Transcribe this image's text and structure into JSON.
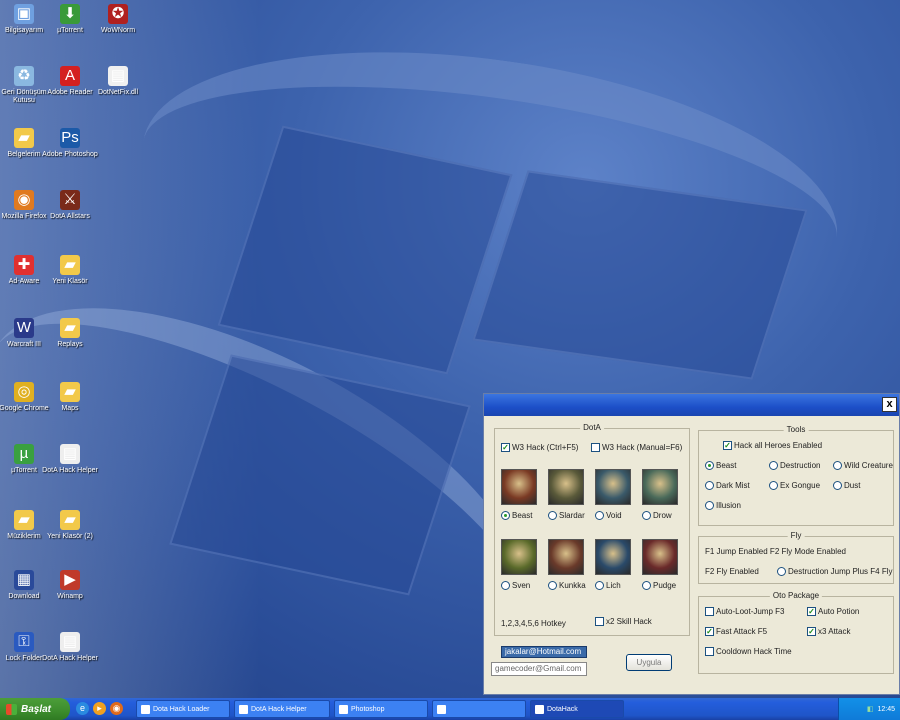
{
  "desktop": {
    "icons": [
      {
        "label": "Bilgisayarım",
        "icon": "computer-icon",
        "color": "#6fa0e0",
        "glyph": "▣"
      },
      {
        "label": "µTorrent",
        "icon": "download-icon",
        "color": "#3a9a3a",
        "glyph": "⬇"
      },
      {
        "label": "WoWNorm",
        "icon": "game-icon",
        "color": "#b02020",
        "glyph": "✪"
      },
      {
        "label": "Geri Dönüşüm Kutusu",
        "icon": "recycle-bin-icon",
        "color": "#8ab8e0",
        "glyph": "♻"
      },
      {
        "label": "Adobe Reader",
        "icon": "pdf-icon",
        "color": "#d42020",
        "glyph": "A"
      },
      {
        "label": "DotNetFix.dll",
        "icon": "file-icon",
        "color": "#f0f0f0",
        "glyph": "▤"
      },
      {
        "label": "Belgelerim",
        "icon": "folder-icon",
        "color": "#f2c94a",
        "glyph": "▰"
      },
      {
        "label": "Adobe Photoshop",
        "icon": "photoshop-icon",
        "color": "#1c5aa8",
        "glyph": "Ps"
      },
      {
        "label": "Mozilla Firefox",
        "icon": "firefox-icon",
        "color": "#e07a1f",
        "glyph": "◉"
      },
      {
        "label": "DotA Allstars",
        "icon": "warcraft-icon",
        "color": "#7a2a1a",
        "glyph": "⚔"
      },
      {
        "label": "Ad-Aware",
        "icon": "shield-icon",
        "color": "#e03030",
        "glyph": "✚"
      },
      {
        "label": "Yeni Klasör",
        "icon": "folder-icon",
        "color": "#f2c94a",
        "glyph": "▰"
      },
      {
        "label": "Warcraft III",
        "icon": "warcraft-icon",
        "color": "#2a3a8a",
        "glyph": "W"
      },
      {
        "label": "Replays",
        "icon": "folder-icon",
        "color": "#f2c94a",
        "glyph": "▰"
      },
      {
        "label": "Google Chrome",
        "icon": "chrome-icon",
        "color": "#e0b020",
        "glyph": "◎"
      },
      {
        "label": "Maps",
        "icon": "folder-icon",
        "color": "#f2c94a",
        "glyph": "▰"
      },
      {
        "label": "µTorrent",
        "icon": "utorrent-icon",
        "color": "#3aa040",
        "glyph": "µ"
      },
      {
        "label": "DotA Hack Helper",
        "icon": "file-icon",
        "color": "#eeeeee",
        "glyph": "▤"
      },
      {
        "label": "Müziklerim",
        "icon": "folder-icon",
        "color": "#f2c94a",
        "glyph": "▰"
      },
      {
        "label": "Yeni Klasör (2)",
        "icon": "folder-icon",
        "color": "#f2c94a",
        "glyph": "▰"
      },
      {
        "label": "Download",
        "icon": "app-icon",
        "color": "#2a4a9a",
        "glyph": "▦"
      },
      {
        "label": "Winamp",
        "icon": "winamp-icon",
        "color": "#c03a2a",
        "glyph": "▶"
      },
      {
        "label": "Lock Folder",
        "icon": "lock-icon",
        "color": "#2a5ac0",
        "glyph": "⚿"
      },
      {
        "label": "DotA Hack Helper",
        "icon": "file-icon",
        "color": "#eeeeee",
        "glyph": "▤"
      }
    ]
  },
  "window": {
    "close_label": "x",
    "dota_group": {
      "title": "DotA",
      "checkbox1": "W3 Hack (Ctrl+F5)",
      "checkbox2": "W3 Hack (Manual=F6)",
      "heroes": [
        {
          "name": "Beast",
          "color": "#7a3a24"
        },
        {
          "name": "Slardar",
          "color": "#5a5a3a"
        },
        {
          "name": "Void",
          "color": "#3a5a6a"
        },
        {
          "name": "Drow",
          "color": "#4a6a5a"
        },
        {
          "name": "Sven",
          "color": "#5a6a2a"
        },
        {
          "name": "Kunkka",
          "color": "#6a3a2a"
        },
        {
          "name": "Lich",
          "color": "#2a4a6a"
        },
        {
          "name": "Pudge",
          "color": "#6a2a2a"
        }
      ],
      "hotkey_note": "1,2,3,4,5,6 Hotkey",
      "skill_checkbox": "x2 Skill Hack",
      "selected_hero": 0
    },
    "tools_group": {
      "title": "Tools",
      "checkbox": "Hack all Heroes Enabled",
      "radios": [
        "Beast",
        "Destruction",
        "Wild Creature",
        "Dark Mist",
        "Ex Gongue",
        "Dust",
        "Illusion"
      ],
      "selected": 0
    },
    "fly_group": {
      "title": "Fly",
      "row1": "F1 Jump Enabled   F2 Fly Mode Enabled",
      "row2": "F2 Fly Enabled",
      "row2_option": "Destruction Jump Plus F4 Fly"
    },
    "auto_group": {
      "title": "Oto Package",
      "items": [
        {
          "label": "Auto-Loot-Jump F3",
          "checked": false
        },
        {
          "label": "Auto Potion",
          "checked": true
        },
        {
          "label": "Fast Attack F5",
          "checked": true
        },
        {
          "label": "x3 Attack",
          "checked": true
        },
        {
          "label": "Cooldown Hack Time",
          "checked": false
        }
      ]
    },
    "contact1": "jakalar@Hotmail.com",
    "contact2": "gamecoder@Gmail.com",
    "apply_button": "Uygula"
  },
  "taskbar": {
    "start_label": "Başlat",
    "tasks": [
      {
        "label": "Dota Hack Loader",
        "icon": "firefox-icon"
      },
      {
        "label": "DotA Hack Helper",
        "icon": "file-icon"
      },
      {
        "label": "Photoshop",
        "icon": "photoshop-icon"
      },
      {
        "label": "",
        "icon": "window-icon"
      },
      {
        "label": "DotaHack",
        "icon": "warcraft-icon"
      }
    ],
    "clock": "12:45"
  }
}
